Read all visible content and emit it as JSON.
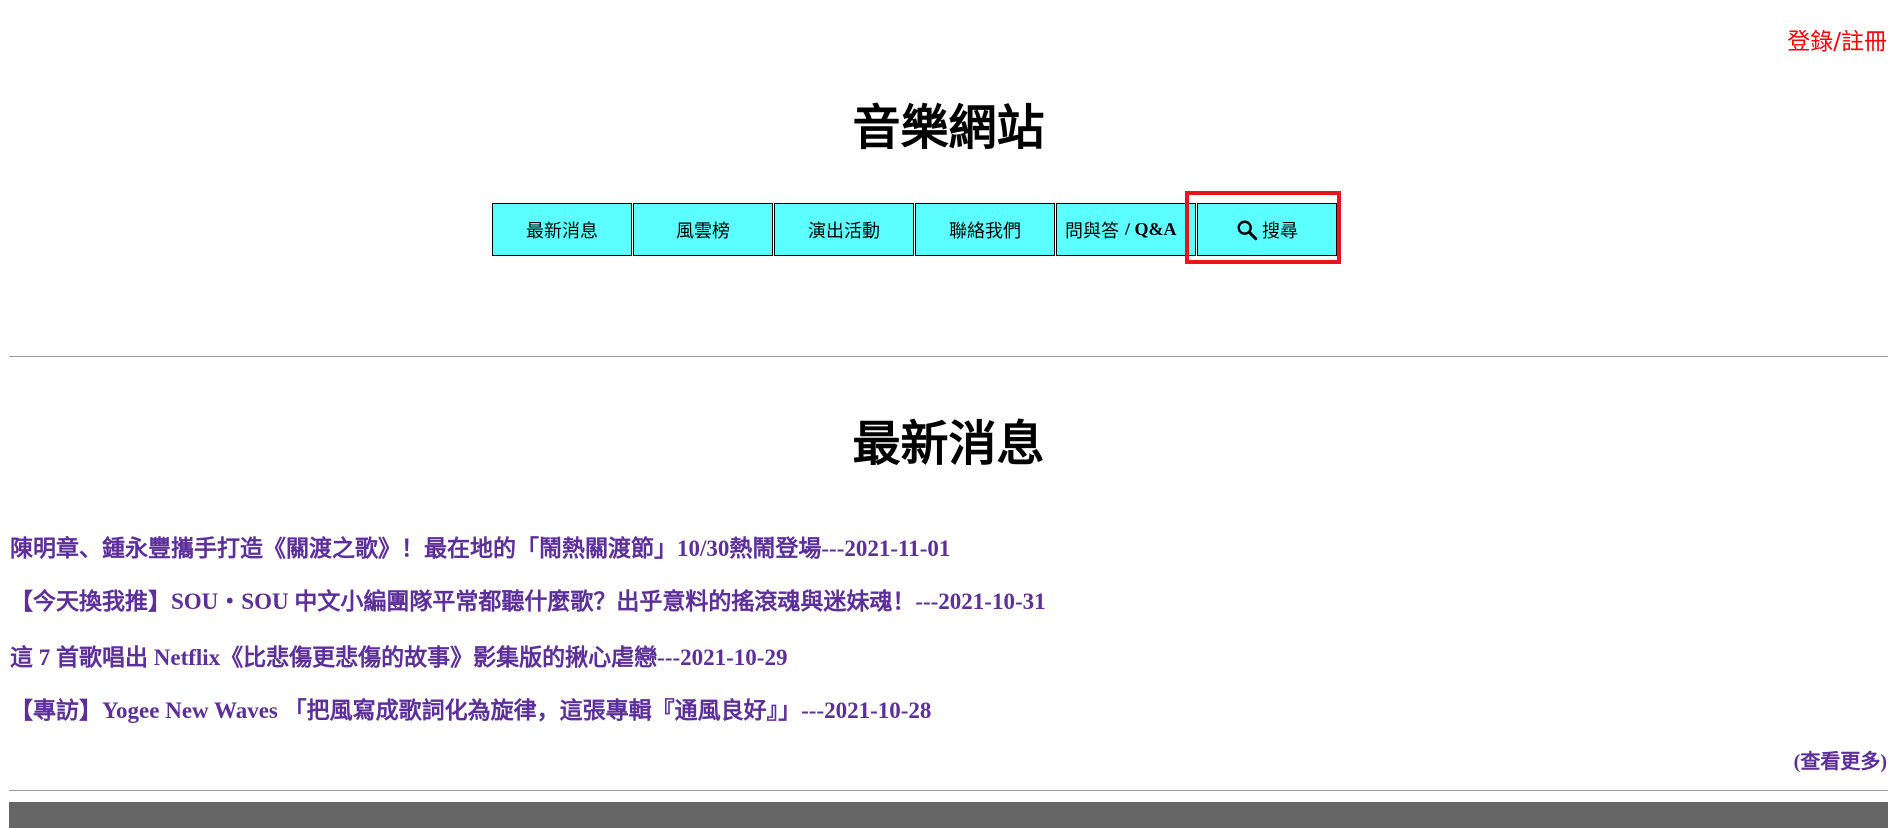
{
  "header": {
    "login_label": "登錄/註冊",
    "site_title": "音樂網站"
  },
  "nav": {
    "items": [
      {
        "label": "最新消息"
      },
      {
        "label": "風雲榜"
      },
      {
        "label": "演出活動"
      },
      {
        "label": "聯絡我們"
      },
      {
        "label": "問與答",
        "suffix": "/ Q&A"
      }
    ],
    "search": {
      "label": "搜尋",
      "icon": "search-icon"
    }
  },
  "main": {
    "section_title": "最新消息",
    "news": [
      {
        "text": "陳明章、鍾永豐攜手打造《關渡之歌》！最在地的「鬧熱關渡節」10/30熱鬧登場---2021-11-01"
      },
      {
        "text": "【今天換我推】SOU・SOU 中文小編團隊平常都聽什麼歌？出乎意料的搖滾魂與迷妹魂！---2021-10-31"
      },
      {
        "text": "這 7 首歌唱出 Netflix《比悲傷更悲傷的故事》影集版的揪心虐戀---2021-10-29"
      },
      {
        "text": "【專訪】Yogee New Waves 「把風寫成歌詞化為旋律，這張專輯『通風良好』」---2021-10-28"
      }
    ],
    "more_label": "(查看更多)"
  },
  "colors": {
    "nav_bg": "#5cffff",
    "link": "#5d2f9b",
    "login": "#ff0000",
    "highlight": "#e8161c",
    "footer": "#666666"
  }
}
